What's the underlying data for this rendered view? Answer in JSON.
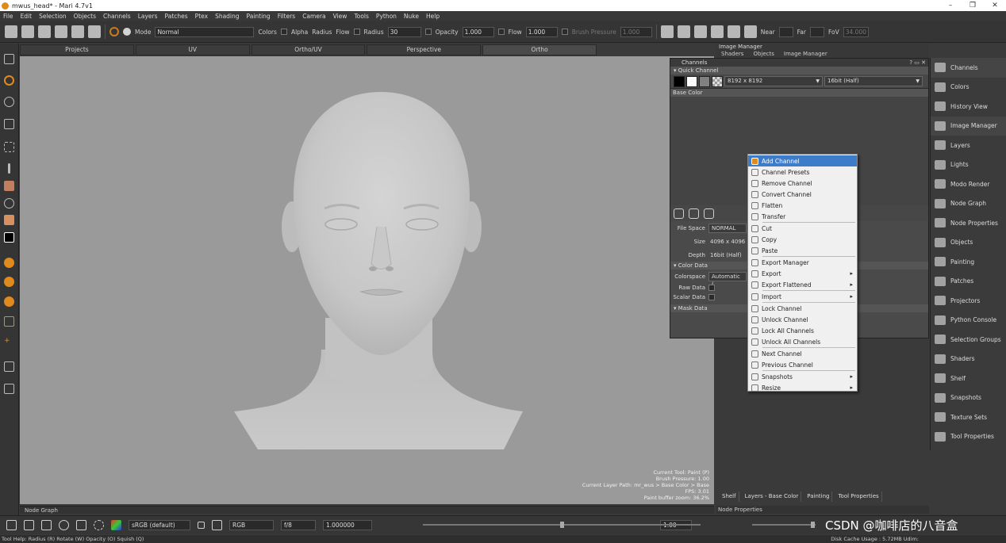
{
  "window": {
    "title": "mwus_head* - Mari 4.7v1",
    "controls": [
      "–",
      "❐",
      "✕"
    ]
  },
  "menu": [
    "File",
    "Edit",
    "Selection",
    "Objects",
    "Channels",
    "Layers",
    "Patches",
    "Ptex",
    "Shading",
    "Painting",
    "Filters",
    "Camera",
    "View",
    "Tools",
    "Python",
    "Nuke",
    "Help"
  ],
  "toolbar": {
    "mode_label": "Mode",
    "mode_value": "Normal",
    "colors_label": "Colors",
    "alpha_label": "Alpha",
    "radius_check_label": "Radius",
    "flow_check_label": "Flow",
    "radius_label": "Radius",
    "radius_value": "30",
    "opacity_label": "Opacity",
    "opacity_value": "1.000",
    "flow_label": "Flow",
    "flow_value": "1.000",
    "brush_pressure_label": "Brush Pressure",
    "brush_pressure_value": "1.000",
    "near_label": "Near",
    "far_label": "Far",
    "fov_label": "FoV",
    "fov_value": "34.000"
  },
  "view_tabs": [
    "Projects",
    "UV",
    "Ortho/UV",
    "Perspective",
    "Ortho"
  ],
  "viewport_info": [
    "Current Tool: Paint (P)",
    "Brush Pressure: 1.00",
    "Current Layer Path: mr_wus > Base Color > Base",
    "FPS: 3.01",
    "Paint buffer zoom: 36.2%"
  ],
  "image_manager": {
    "title": "Image Manager",
    "tabs": [
      "Shaders",
      "Objects",
      "Image Manager"
    ]
  },
  "channels_panel": {
    "title": "Channels",
    "quick_channel": "Quick Channel",
    "resolution": "8192 x 8192",
    "depth": "16bit (Half)",
    "channel_name": "Base Color",
    "file_space_label": "File Space",
    "file_space_value": "NORMAL",
    "size_label": "Size",
    "size_value": "4096 x 4096",
    "depth_label": "Depth",
    "depth_value": "16bit (Half)",
    "color_data": "Color Data",
    "colorspace_label": "Colorspace",
    "colorspace_value": "Automatic (",
    "raw_data_label": "Raw Data",
    "scalar_data_label": "Scalar Data",
    "mask_data": "Mask Data"
  },
  "context_menu": [
    {
      "label": "Add Channel",
      "highlight": true
    },
    {
      "label": "Channel Presets"
    },
    {
      "label": "Remove Channel"
    },
    {
      "label": "Convert Channel"
    },
    {
      "label": "Flatten"
    },
    {
      "label": "Transfer"
    },
    {
      "sep": true
    },
    {
      "label": "Cut"
    },
    {
      "label": "Copy"
    },
    {
      "label": "Paste"
    },
    {
      "sep": true
    },
    {
      "label": "Export Manager"
    },
    {
      "label": "Export",
      "submenu": true
    },
    {
      "label": "Export Flattened",
      "submenu": true
    },
    {
      "sep": true
    },
    {
      "label": "Import",
      "submenu": true
    },
    {
      "sep": true
    },
    {
      "label": "Lock Channel"
    },
    {
      "label": "Unlock Channel"
    },
    {
      "label": "Lock All Channels"
    },
    {
      "label": "Unlock All Channels"
    },
    {
      "sep": true
    },
    {
      "label": "Next Channel"
    },
    {
      "label": "Previous Channel"
    },
    {
      "sep": true
    },
    {
      "label": "Snapshots",
      "submenu": true
    },
    {
      "label": "Resize",
      "submenu": true
    }
  ],
  "right_panel": [
    "Channels",
    "Colors",
    "History View",
    "Image Manager",
    "Layers",
    "Lights",
    "Modo Render",
    "Node Graph",
    "Node Properties",
    "Objects",
    "Painting",
    "Patches",
    "Projectors",
    "Python Console",
    "Selection Groups",
    "Shaders",
    "Shelf",
    "Snapshots",
    "Texture Sets",
    "Tool Properties"
  ],
  "shelf_tabs": [
    "Shelf",
    "Layers - Base Color",
    "Painting",
    "Tool Properties"
  ],
  "node_graph_label": "Node Graph",
  "node_properties_label": "Node Properties",
  "bottom": {
    "colorspace": "sRGB (default)",
    "channel": "RGB",
    "fstop": "f/8",
    "exposure": "1.000000",
    "gamma": "1.00"
  },
  "status": {
    "left": "Tool Help:   Radius (R)   Rotate (W)   Opacity (O)   Squish (Q)",
    "right": "Disk Cache Usage : 5.72MB Udim:"
  },
  "watermark": "CSDN @咖啡店的八音盒",
  "colors": {
    "accent": "#e08a1e",
    "highlight": "#3d7cc9",
    "viewport_bg": "#9a9a9a"
  }
}
